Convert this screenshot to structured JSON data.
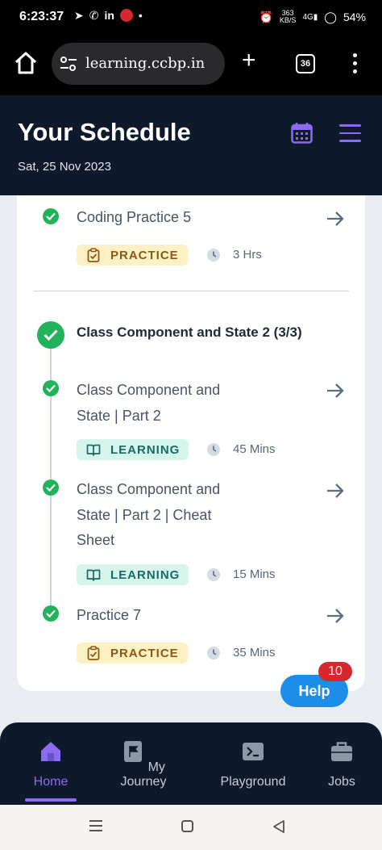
{
  "status_bar": {
    "time": "6:23:37",
    "icons": [
      "telegram-icon",
      "whatsapp-icon",
      "linkedin-icon",
      "jio-icon",
      "dot-icon"
    ],
    "net_speed_value": "363",
    "net_speed_unit": "KB/S",
    "network": "4G",
    "battery": "54%"
  },
  "browser": {
    "url": "learning.ccbp.in",
    "tab_count": "36"
  },
  "header": {
    "title": "Your Schedule",
    "date": "Sat, 25 Nov 2023"
  },
  "schedule": {
    "first_item": {
      "title": "Coding Practice 5",
      "tag": "PRACTICE",
      "duration": "3 Hrs"
    },
    "section": {
      "title": "Class Component and State 2 (3/3)",
      "items": [
        {
          "title_line1": "Class Component and",
          "title_line2": "State | Part 2",
          "title_line3": "",
          "tag": "LEARNING",
          "duration": "45 Mins"
        },
        {
          "title_line1": "Class Component and",
          "title_line2": "State | Part 2 | Cheat",
          "title_line3": "Sheet",
          "tag": "LEARNING",
          "duration": "15 Mins"
        },
        {
          "title_line1": "Practice 7",
          "title_line2": "",
          "title_line3": "",
          "tag": "PRACTICE",
          "duration": "35 Mins"
        }
      ]
    }
  },
  "help": {
    "label": "Help",
    "badge": "10"
  },
  "bottom_nav": {
    "items": [
      {
        "label": "Home",
        "icon": "home-icon"
      },
      {
        "label": "My Journey",
        "icon": "flag-icon"
      },
      {
        "label": "Playground",
        "icon": "terminal-icon"
      },
      {
        "label": "Jobs",
        "icon": "briefcase-icon"
      }
    ]
  },
  "colors": {
    "header_bg": "#0e1a2b",
    "accent": "#8b6cf0",
    "success": "#22b35a",
    "help_blue": "#1c8de8",
    "badge_red": "#d6262e"
  }
}
